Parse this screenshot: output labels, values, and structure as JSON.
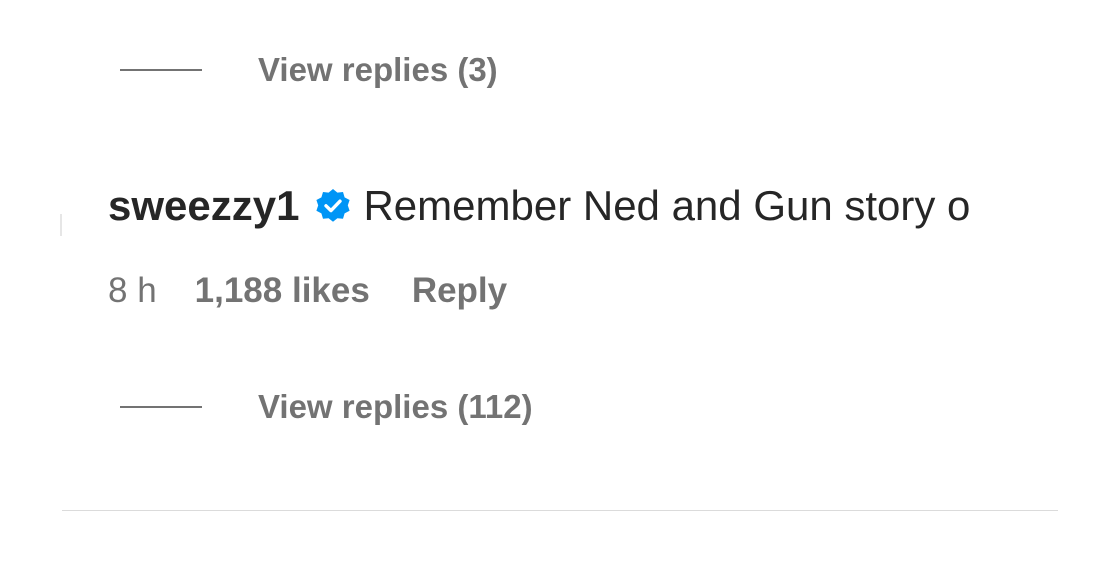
{
  "thread": {
    "top_view_replies": "View replies (3)",
    "comment": {
      "username": "sweezzy1",
      "verified": true,
      "text": "Remember Ned and Gun story o",
      "time": "8 h",
      "likes": "1,188 likes",
      "reply_label": "Reply"
    },
    "bottom_view_replies": "View replies (112)"
  },
  "colors": {
    "primary_text": "#262626",
    "secondary_text": "#737373",
    "verified_badge": "#0095f6",
    "divider": "#dbdbdb"
  },
  "icons": {
    "verified": "verified-badge-icon"
  }
}
